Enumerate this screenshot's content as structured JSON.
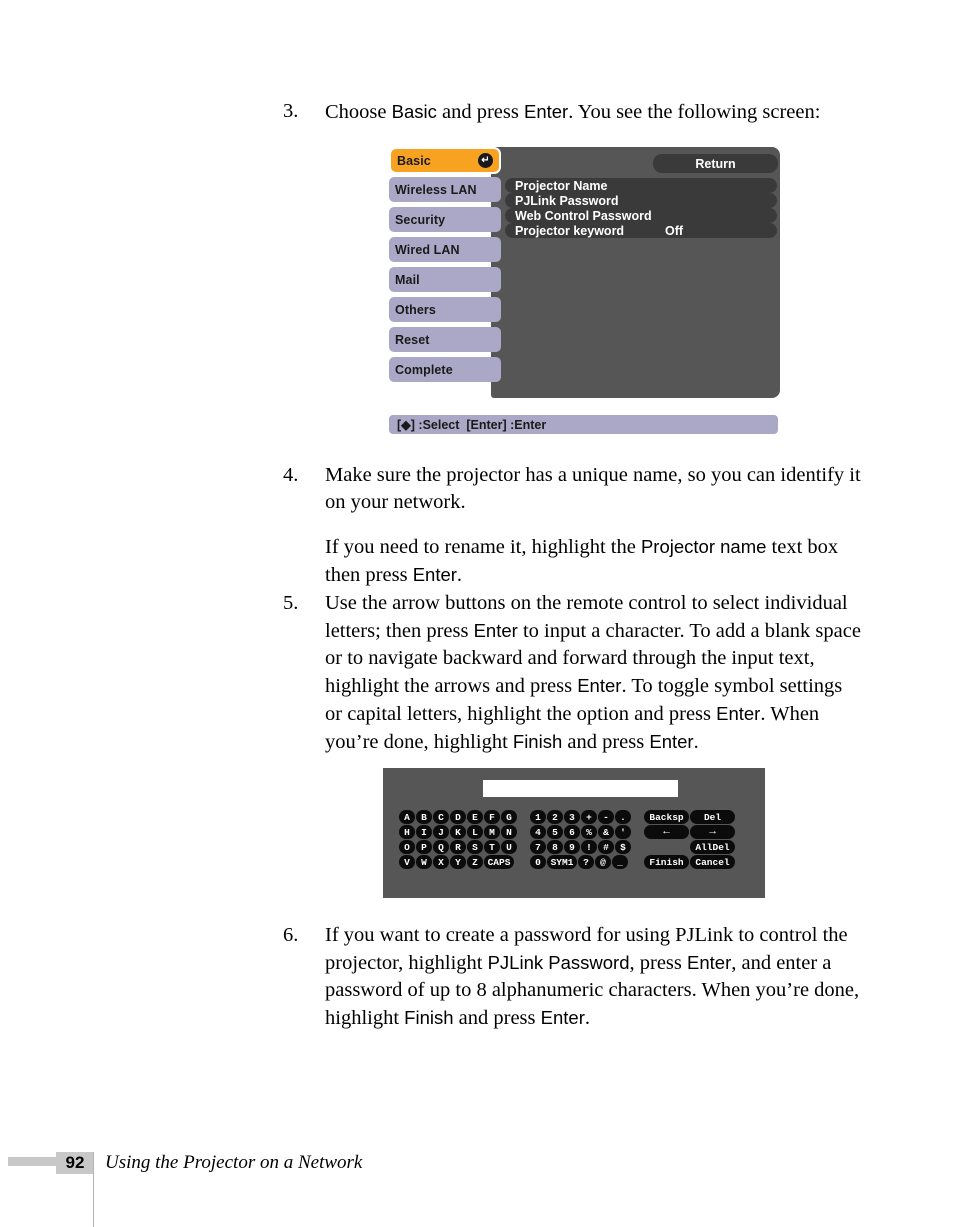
{
  "steps": [
    {
      "number": "3.",
      "paragraphs": [
        [
          {
            "t": "Choose ",
            "ui": false
          },
          {
            "t": "Basic",
            "ui": true
          },
          {
            "t": " and press ",
            "ui": false
          },
          {
            "t": "Enter",
            "ui": true
          },
          {
            "t": ". You see the following screen:",
            "ui": false
          }
        ]
      ]
    },
    {
      "number": "4.",
      "paragraphs": [
        [
          {
            "t": "Make sure the projector has a unique name, so you can identify it on your network.",
            "ui": false
          }
        ],
        [
          {
            "t": "If you need to rename it, highlight the ",
            "ui": false
          },
          {
            "t": "Projector name",
            "ui": true
          },
          {
            "t": " text box then press ",
            "ui": false
          },
          {
            "t": "Enter",
            "ui": true
          },
          {
            "t": ".",
            "ui": false
          }
        ]
      ]
    },
    {
      "number": "5.",
      "paragraphs": [
        [
          {
            "t": "Use the arrow buttons on the remote control to select individual letters; then press ",
            "ui": false
          },
          {
            "t": "Enter",
            "ui": true
          },
          {
            "t": " to input a character. To add a blank space or to navigate backward and forward through the input text, highlight the arrows and press ",
            "ui": false
          },
          {
            "t": "Enter",
            "ui": true
          },
          {
            "t": ". To toggle symbol settings or capital letters, highlight the option and press ",
            "ui": false
          },
          {
            "t": "Enter",
            "ui": true
          },
          {
            "t": ". When you’re done, highlight ",
            "ui": false
          },
          {
            "t": "Finish",
            "ui": true
          },
          {
            "t": " and press ",
            "ui": false
          },
          {
            "t": "Enter",
            "ui": true
          },
          {
            "t": ".",
            "ui": false
          }
        ]
      ]
    },
    {
      "number": "6.",
      "paragraphs": [
        [
          {
            "t": "If you want to create a password for using PJLink to control the projector, highlight ",
            "ui": false
          },
          {
            "t": "PJLink Password",
            "ui": true
          },
          {
            "t": ", press ",
            "ui": false
          },
          {
            "t": "Enter",
            "ui": true
          },
          {
            "t": ", and enter a password of up to 8 alphanumeric characters. When you’re done, highlight ",
            "ui": false
          },
          {
            "t": "Finish",
            "ui": true
          },
          {
            "t": " and press ",
            "ui": false
          },
          {
            "t": "Enter",
            "ui": true
          },
          {
            "t": ".",
            "ui": false
          }
        ]
      ]
    }
  ],
  "osd_menu": {
    "tabs": [
      {
        "label": "Basic",
        "selected": true,
        "badge": "↵"
      },
      {
        "label": "Wireless LAN",
        "selected": false
      },
      {
        "label": "Security",
        "selected": false
      },
      {
        "label": "Wired LAN",
        "selected": false
      },
      {
        "label": "Mail",
        "selected": false
      },
      {
        "label": "Others",
        "selected": false
      },
      {
        "label": "Reset",
        "selected": false
      },
      {
        "label": "Complete",
        "selected": false
      }
    ],
    "return_label": "Return",
    "rows": [
      {
        "label": "Projector Name",
        "value": ""
      },
      {
        "label": "PJLink Password",
        "value": ""
      },
      {
        "label": "Web Control Password",
        "value": ""
      },
      {
        "label": "Projector keyword",
        "value": "Off"
      }
    ],
    "status_bar": "[◆] :Select  [Enter] :Enter",
    "colors": {
      "panel_bg": "#565656",
      "tab_bg": "#aaa8c6",
      "tab_selected_bg": "#f7a220",
      "row_bg": "#3a3a3a",
      "status_bg": "#aaa8c6"
    }
  },
  "keyboard": {
    "input_value": "",
    "letter_rows": [
      [
        "A",
        "B",
        "C",
        "D",
        "E",
        "F",
        "G"
      ],
      [
        "H",
        "I",
        "J",
        "K",
        "L",
        "M",
        "N"
      ],
      [
        "O",
        "P",
        "Q",
        "R",
        "S",
        "T",
        "U"
      ],
      [
        "V",
        "W",
        "X",
        "Y",
        "Z",
        "CAPS"
      ]
    ],
    "symbol_rows": [
      [
        "1",
        "2",
        "3",
        "+",
        "-",
        "."
      ],
      [
        "4",
        "5",
        "6",
        "%",
        "&",
        "'"
      ],
      [
        "7",
        "8",
        "9",
        "!",
        "#",
        "$"
      ],
      [
        "0",
        "SYM1",
        "?",
        "@",
        "_"
      ]
    ],
    "function_rows": [
      [
        "Backsp",
        "Del"
      ],
      [
        "←",
        "→"
      ],
      [
        "",
        "AllDel"
      ],
      [
        "Finish",
        "Cancel"
      ]
    ]
  },
  "footer": {
    "page_number": "92",
    "title": "Using the Projector on a Network"
  }
}
